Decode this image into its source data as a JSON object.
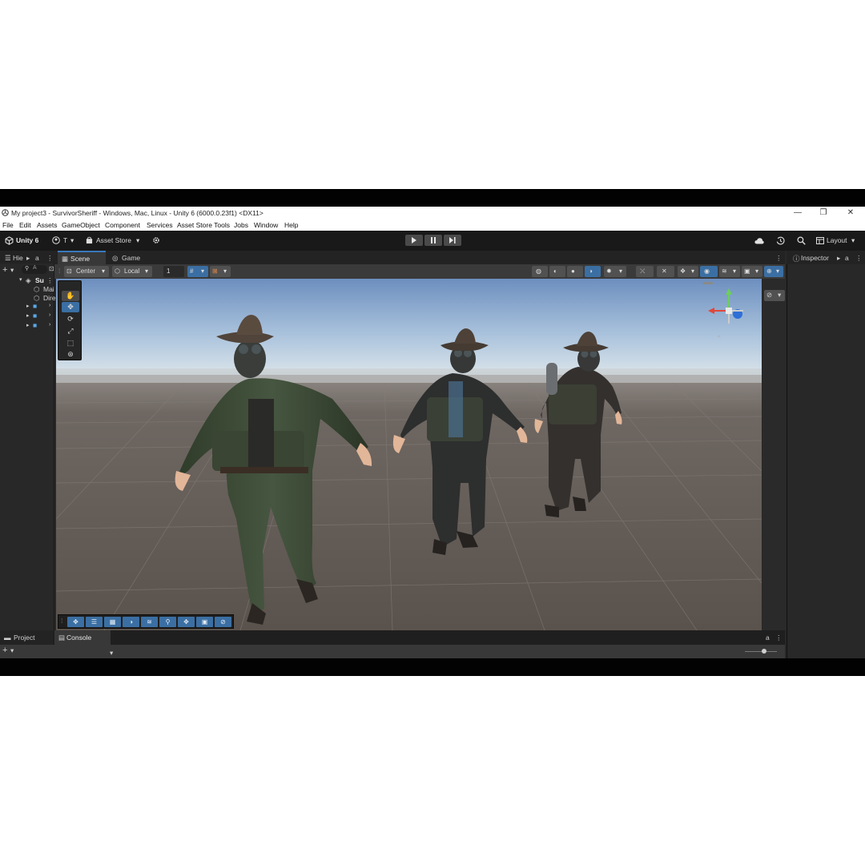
{
  "window": {
    "title": "My project3 - SurvivorSheriff - Windows, Mac, Linux - Unity 6 (6000.0.23f1) <DX11>",
    "minimize": "—",
    "maximize": "❐",
    "close": "✕"
  },
  "menu": [
    "File",
    "Edit",
    "Assets",
    "GameObject",
    "Component",
    "Services",
    "Asset Store Tools",
    "Jobs",
    "Window",
    "Help"
  ],
  "toolbar": {
    "account": "Unity 6",
    "user_initial": "T",
    "asset_store": "Asset Store",
    "layout": "Layout"
  },
  "hierarchy": {
    "tab_label": "Hie",
    "search_placeholder": "A",
    "scene_root": "Su",
    "children": [
      "Mai",
      "Dire"
    ]
  },
  "scene_tabs": {
    "scene": "Scene",
    "game": "Game"
  },
  "scene_toolbar": {
    "pivot": "Center",
    "space": "Local",
    "snap_value": "1"
  },
  "inspector": {
    "tab_label": "Inspector"
  },
  "bottom": {
    "project": "Project",
    "console": "Console"
  },
  "colors": {
    "accent": "#3b6fa3",
    "tab_highlight": "#3a79bb",
    "editor_bg": "#282828",
    "toolbar_bg": "#191919"
  }
}
